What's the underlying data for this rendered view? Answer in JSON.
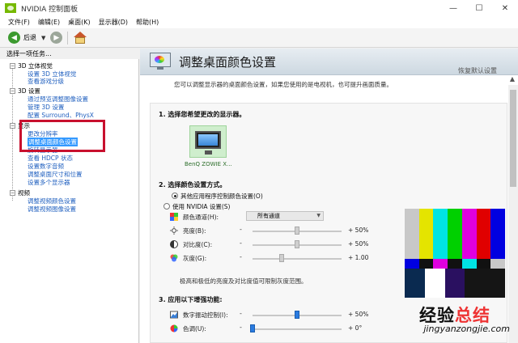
{
  "window": {
    "title": "NVIDIA 控制面板",
    "min": "—",
    "max": "☐",
    "close": "✕"
  },
  "menu": [
    "文件(F)",
    "编辑(E)",
    "桌面(K)",
    "显示器(D)",
    "帮助(H)"
  ],
  "toolbar": {
    "back_label": "后退"
  },
  "left": {
    "header": "选择一项任务...",
    "categories": [
      {
        "label": "3D 立体视觉",
        "items": [
          "设置 3D 立体视觉",
          "查看游戏分级"
        ]
      },
      {
        "label": "3D 设置",
        "items": [
          "通过预览调整图像设置",
          "管理 3D 设置",
          "配置 Surround、PhysX"
        ]
      },
      {
        "label": "显示",
        "items": [
          "更改分辨率",
          "调整桌面颜色设置",
          "旋转显示器",
          "查看 HDCP 状态",
          "设置数字音频",
          "调整桌面尺寸和位置",
          "设置多个显示器"
        ]
      },
      {
        "label": "视频",
        "items": [
          "调整视频颜色设置",
          "调整视频图像设置"
        ]
      }
    ]
  },
  "right": {
    "title": "调整桌面颜色设置",
    "restore": "恢复默认设置",
    "description": "您可以调整显示器的桌面颜色设置，如果您使用的是电视机，也可提升画面质量。",
    "section1": "1. 选择您希望更改的显示器。",
    "monitor_label": "BenQ ZOWIE X...",
    "section2": "2. 选择颜色设置方式。",
    "opt_other": "其他应用程序控制颜色设置(O)",
    "opt_nvidia": "使用 NVIDIA 设置(S)",
    "channel_label": "颜色通道(H):",
    "channel_value": "所有通道",
    "rows": [
      {
        "label": "亮度(B):",
        "value": "+  50%",
        "level": 0.5
      },
      {
        "label": "对比度(C):",
        "value": "+  50%",
        "level": 0.5
      },
      {
        "label": "灰度(G):",
        "value": "+  1.00",
        "level": 0.33
      }
    ],
    "note": "极高和极低的亮度及对比度值可限制灰度范围。",
    "section3": "3. 应用以下增强功能:",
    "enh_rows": [
      {
        "label": "数字振动控制(I):",
        "value": "+  50%",
        "level": 0.5
      },
      {
        "label": "色调(U):",
        "value": "+  0°",
        "level": 0.0
      }
    ]
  },
  "watermark": {
    "cn_a": "经验",
    "cn_b": "总结",
    "url": "jingyanzongjie.com"
  },
  "colors": {
    "accent_red": "#c8102e",
    "selected_bg": "#3399ff",
    "nvidia_green": "#76b900"
  }
}
